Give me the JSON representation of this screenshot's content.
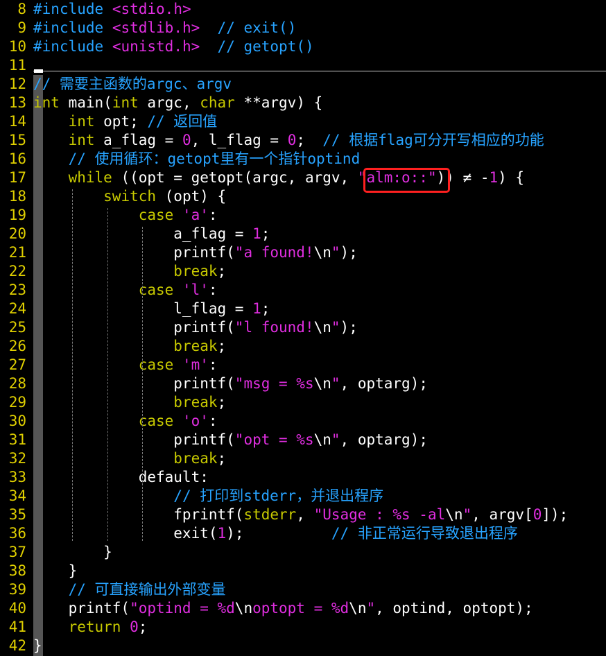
{
  "editor": {
    "lines": [
      {
        "n": "8",
        "tokens": [
          [
            "preproc",
            "#"
          ],
          [
            "preproc",
            "include "
          ],
          [
            "inc",
            "<stdio.h>"
          ]
        ]
      },
      {
        "n": "9",
        "tokens": [
          [
            "preproc",
            "#"
          ],
          [
            "preproc",
            "include "
          ],
          [
            "inc",
            "<stdlib.h>"
          ],
          [
            "plain",
            "  "
          ],
          [
            "cmt",
            "// exit()"
          ]
        ]
      },
      {
        "n": "10",
        "tokens": [
          [
            "preproc",
            "#"
          ],
          [
            "preproc",
            "include "
          ],
          [
            "inc",
            "<unistd.h>"
          ],
          [
            "plain",
            "  "
          ],
          [
            "cmt",
            "// getopt()"
          ]
        ]
      },
      {
        "n": "11",
        "tokens": []
      },
      {
        "n": "12",
        "tokens": [
          [
            "cmt",
            "// 需要主函数的argc、argv"
          ]
        ]
      },
      {
        "n": "13",
        "tokens": [
          [
            "kw-type",
            "int"
          ],
          [
            "plain",
            " main("
          ],
          [
            "kw-type",
            "int"
          ],
          [
            "plain",
            " argc, "
          ],
          [
            "kw-type",
            "char"
          ],
          [
            "plain",
            " **argv) {"
          ]
        ]
      },
      {
        "n": "14",
        "tokens": [
          [
            "plain",
            "    "
          ],
          [
            "kw-type",
            "int"
          ],
          [
            "plain",
            " opt; "
          ],
          [
            "cmt",
            "// 返回值"
          ]
        ]
      },
      {
        "n": "15",
        "tokens": [
          [
            "plain",
            "    "
          ],
          [
            "kw-type",
            "int"
          ],
          [
            "plain",
            " a_flag = "
          ],
          [
            "num",
            "0"
          ],
          [
            "plain",
            ", l_flag = "
          ],
          [
            "num",
            "0"
          ],
          [
            "plain",
            ";  "
          ],
          [
            "cmt",
            "// 根据flag可分开写相应的功能"
          ]
        ]
      },
      {
        "n": "16",
        "tokens": [
          [
            "plain",
            "    "
          ],
          [
            "cmt",
            "// 使用循环：getopt里有一个指针optind"
          ]
        ]
      },
      {
        "n": "17",
        "tokens": [
          [
            "plain",
            "    "
          ],
          [
            "kw-flow",
            "while"
          ],
          [
            "plain",
            " ((opt = getopt(argc, argv, "
          ],
          [
            "str",
            "\"alm:o::\""
          ],
          [
            "plain",
            ")) ≠ -"
          ],
          [
            "num",
            "1"
          ],
          [
            "plain",
            ") {"
          ]
        ]
      },
      {
        "n": "18",
        "tokens": [
          [
            "plain",
            "        "
          ],
          [
            "kw-flow",
            "switch"
          ],
          [
            "plain",
            " (opt) {"
          ]
        ]
      },
      {
        "n": "19",
        "tokens": [
          [
            "plain",
            "            "
          ],
          [
            "kw-flow",
            "case"
          ],
          [
            "plain",
            " "
          ],
          [
            "chr",
            "'a'"
          ],
          [
            "plain",
            ":"
          ]
        ]
      },
      {
        "n": "20",
        "tokens": [
          [
            "plain",
            "                a_flag = "
          ],
          [
            "num",
            "1"
          ],
          [
            "plain",
            ";"
          ]
        ]
      },
      {
        "n": "21",
        "tokens": [
          [
            "plain",
            "                printf("
          ],
          [
            "str",
            "\"a found!"
          ],
          [
            "esc",
            "\\n"
          ],
          [
            "str",
            "\""
          ],
          [
            "plain",
            ");"
          ]
        ]
      },
      {
        "n": "22",
        "tokens": [
          [
            "plain",
            "                "
          ],
          [
            "kw-flow",
            "break"
          ],
          [
            "plain",
            ";"
          ]
        ]
      },
      {
        "n": "23",
        "tokens": [
          [
            "plain",
            "            "
          ],
          [
            "kw-flow",
            "case"
          ],
          [
            "plain",
            " "
          ],
          [
            "chr",
            "'l'"
          ],
          [
            "plain",
            ":"
          ]
        ]
      },
      {
        "n": "24",
        "tokens": [
          [
            "plain",
            "                l_flag = "
          ],
          [
            "num",
            "1"
          ],
          [
            "plain",
            ";"
          ]
        ]
      },
      {
        "n": "25",
        "tokens": [
          [
            "plain",
            "                printf("
          ],
          [
            "str",
            "\"l found!"
          ],
          [
            "esc",
            "\\n"
          ],
          [
            "str",
            "\""
          ],
          [
            "plain",
            ");"
          ]
        ]
      },
      {
        "n": "26",
        "tokens": [
          [
            "plain",
            "                "
          ],
          [
            "kw-flow",
            "break"
          ],
          [
            "plain",
            ";"
          ]
        ]
      },
      {
        "n": "27",
        "tokens": [
          [
            "plain",
            "            "
          ],
          [
            "kw-flow",
            "case"
          ],
          [
            "plain",
            " "
          ],
          [
            "chr",
            "'m'"
          ],
          [
            "plain",
            ":"
          ]
        ]
      },
      {
        "n": "28",
        "tokens": [
          [
            "plain",
            "                printf("
          ],
          [
            "str",
            "\"msg = %s"
          ],
          [
            "esc",
            "\\n"
          ],
          [
            "str",
            "\""
          ],
          [
            "plain",
            ", optarg);"
          ]
        ]
      },
      {
        "n": "29",
        "tokens": [
          [
            "plain",
            "                "
          ],
          [
            "kw-flow",
            "break"
          ],
          [
            "plain",
            ";"
          ]
        ]
      },
      {
        "n": "30",
        "tokens": [
          [
            "plain",
            "            "
          ],
          [
            "kw-flow",
            "case"
          ],
          [
            "plain",
            " "
          ],
          [
            "chr",
            "'o'"
          ],
          [
            "plain",
            ":"
          ]
        ]
      },
      {
        "n": "31",
        "tokens": [
          [
            "plain",
            "                printf("
          ],
          [
            "str",
            "\"opt = %s"
          ],
          [
            "esc",
            "\\n"
          ],
          [
            "str",
            "\""
          ],
          [
            "plain",
            ", optarg);"
          ]
        ]
      },
      {
        "n": "32",
        "tokens": [
          [
            "plain",
            "                "
          ],
          [
            "kw-flow",
            "break"
          ],
          [
            "plain",
            ";"
          ]
        ]
      },
      {
        "n": "33",
        "tokens": [
          [
            "plain",
            "            default:"
          ]
        ]
      },
      {
        "n": "34",
        "tokens": [
          [
            "plain",
            "                "
          ],
          [
            "cmt",
            "// 打印到stderr，并退出程序"
          ]
        ]
      },
      {
        "n": "35",
        "tokens": [
          [
            "plain",
            "                fprintf("
          ],
          [
            "kw-type",
            "stderr"
          ],
          [
            "plain",
            ", "
          ],
          [
            "str",
            "\"Usage : %s -al"
          ],
          [
            "esc",
            "\\n"
          ],
          [
            "str",
            "\""
          ],
          [
            "plain",
            ", argv["
          ],
          [
            "num",
            "0"
          ],
          [
            "plain",
            "]);"
          ]
        ]
      },
      {
        "n": "36",
        "tokens": [
          [
            "plain",
            "                exit("
          ],
          [
            "num",
            "1"
          ],
          [
            "plain",
            ");          "
          ],
          [
            "cmt",
            "// 非正常运行导致退出程序"
          ]
        ]
      },
      {
        "n": "37",
        "tokens": [
          [
            "plain",
            "        }"
          ]
        ]
      },
      {
        "n": "38",
        "tokens": [
          [
            "plain",
            "    }"
          ]
        ]
      },
      {
        "n": "39",
        "tokens": [
          [
            "plain",
            "    "
          ],
          [
            "cmt",
            "// 可直接输出外部变量"
          ]
        ]
      },
      {
        "n": "40",
        "tokens": [
          [
            "plain",
            "    printf("
          ],
          [
            "str",
            "\"optind = %d"
          ],
          [
            "esc",
            "\\n"
          ],
          [
            "str",
            "optopt = %d"
          ],
          [
            "esc",
            "\\n"
          ],
          [
            "str",
            "\""
          ],
          [
            "plain",
            ", optind, optopt);"
          ]
        ]
      },
      {
        "n": "41",
        "tokens": [
          [
            "plain",
            "    "
          ],
          [
            "kw-flow",
            "return"
          ],
          [
            "plain",
            " "
          ],
          [
            "num",
            "0"
          ],
          [
            "plain",
            ";"
          ]
        ]
      },
      {
        "n": "42",
        "tokens": [
          [
            "plain",
            "}"
          ]
        ]
      }
    ]
  },
  "colors": {
    "background": "#000000",
    "line_number": "#e0d000",
    "keyword": "#c8ca00",
    "comment": "#27a3ff",
    "string": "#e02ee0",
    "highlight_box": "#ff2020"
  }
}
